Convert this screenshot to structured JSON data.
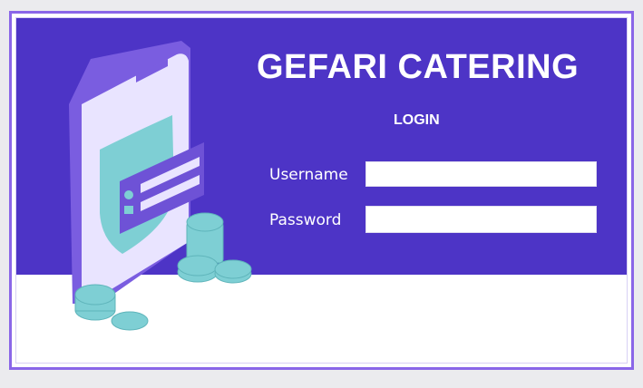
{
  "app": {
    "title": "GEFARI CATERING",
    "subtitle": "LOGIN"
  },
  "form": {
    "username_label": "Username",
    "username_value": "",
    "password_label": "Password",
    "password_value": ""
  },
  "colors": {
    "panel": "#4d34c6",
    "frame": "#8a66e8",
    "background": "#ebebee",
    "accent_teal": "#7ecfd4",
    "phone_light": "#e9e4ff"
  },
  "illustration": {
    "description_icon": "phone-security-coins-illustration"
  }
}
